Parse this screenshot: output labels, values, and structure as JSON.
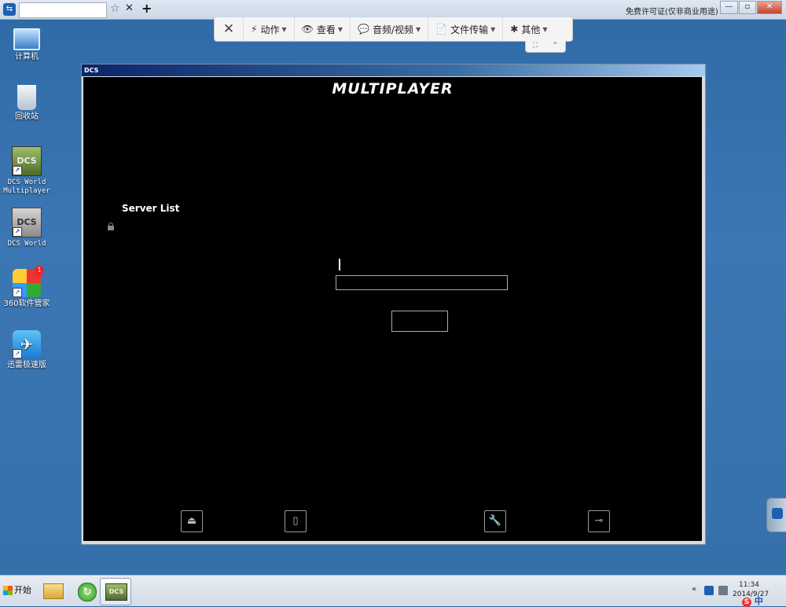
{
  "teamviewer": {
    "tab_title": "",
    "new_tab": "+",
    "tab_close": "✕",
    "favorite": "☆",
    "license_text": "免费许可证(仅非商业用途)",
    "window_buttons": {
      "minimize": "—",
      "restore": "▫",
      "close": "✕"
    },
    "toolbar": {
      "close": "✕",
      "items": [
        {
          "label": "动作",
          "icon": "⚡"
        },
        {
          "label": "查看",
          "icon": "👁"
        },
        {
          "label": "音频/视频",
          "icon": "💬"
        },
        {
          "label": "文件传输",
          "icon": "📄"
        },
        {
          "label": "其他",
          "icon": "✱"
        }
      ],
      "sub_fullscreen": "⛶",
      "sub_collapse": "⌃"
    }
  },
  "desktop_icons": [
    {
      "label": "计算机"
    },
    {
      "label": "回收站"
    },
    {
      "label": "DCS World Multiplayer",
      "logo": "DCS"
    },
    {
      "label": "DCS World",
      "logo": "DCS"
    },
    {
      "label": "360软件管家",
      "badge": "1"
    },
    {
      "label": "迅雷极速版"
    }
  ],
  "dcs_window": {
    "title": "DCS",
    "heading": "MULTIPLAYER",
    "server_list_label": "Server List",
    "input_value": "",
    "button_label": "",
    "footer_buttons": [
      {
        "icon": "eject-icon",
        "glyph": "⏏"
      },
      {
        "icon": "phone-icon",
        "glyph": "▯"
      },
      {
        "icon": "wrench-icon",
        "glyph": "🔧"
      },
      {
        "icon": "connect-icon",
        "glyph": "⊸"
      }
    ]
  },
  "taskbar": {
    "start_label": "开始",
    "dcs_task_logo": "DCS",
    "clock_time": "11:34",
    "clock_date": "2014/9/27",
    "tray_arrow": "«",
    "ime_text": "中"
  }
}
